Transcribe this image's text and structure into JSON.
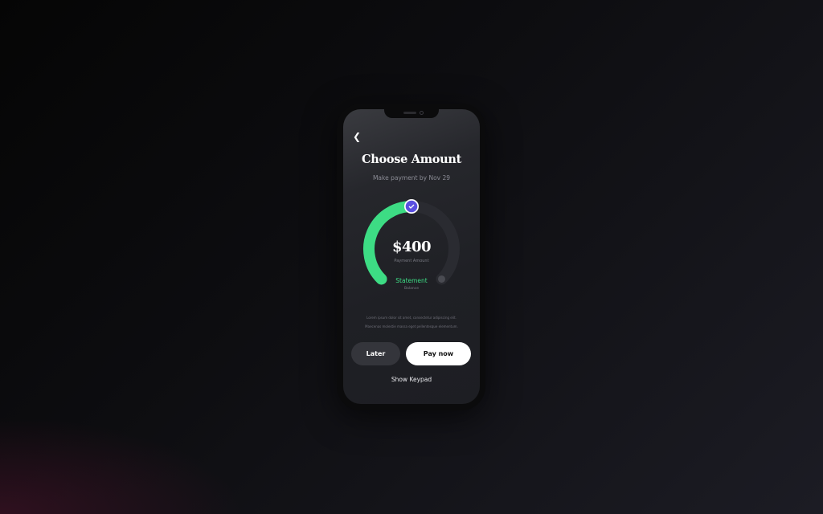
{
  "screen": {
    "title": "Choose Amount",
    "subtitle": "Make payment by Nov 29",
    "gauge": {
      "fraction": 0.5,
      "fill_color": "#3ddc84",
      "knob_color": "#5a4fe0",
      "track_color": "#2a2b31"
    },
    "amount": "$400",
    "amount_label": "Payment Amount",
    "statement_label": "Statement",
    "balance_label": "Balance",
    "description": [
      "Lorem ipsum dolor sit amet, consectetur adipiscing elit.",
      "Maecenas molestie massa eget pellentesque elementum."
    ],
    "later_label": "Later",
    "pay_label": "Pay now",
    "keypad_label": "Show Keypad"
  }
}
